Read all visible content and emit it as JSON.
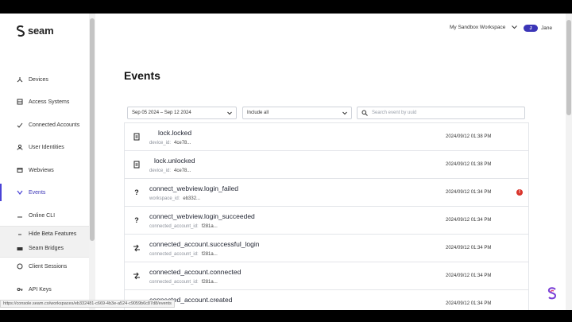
{
  "brand": {
    "name": "seam"
  },
  "header": {
    "workspace": "My Sandbox Workspace",
    "user_initial": "J",
    "user_name": "Jane"
  },
  "sidebar": {
    "items": [
      {
        "label": "Devices",
        "icon": "devices-icon"
      },
      {
        "label": "Access Systems",
        "icon": "access-systems-icon"
      },
      {
        "label": "Connected Accounts",
        "icon": "connected-accounts-icon"
      },
      {
        "label": "User Identities",
        "icon": "user-identities-icon"
      },
      {
        "label": "Webviews",
        "icon": "webviews-icon"
      },
      {
        "label": "Events",
        "icon": "events-icon",
        "active": true
      },
      {
        "label": "Online CLI",
        "icon": "cli-icon"
      }
    ],
    "beta": {
      "toggle_label": "Hide Beta Features",
      "bridges_label": "Seam Bridges"
    },
    "bottom": [
      {
        "label": "Client Sessions",
        "icon": "client-sessions-icon"
      },
      {
        "label": "API Keys",
        "icon": "api-keys-icon"
      }
    ]
  },
  "page": {
    "title": "Events"
  },
  "filters": {
    "date_range": "Sep 05 2024 – Sep 12 2024",
    "include": "Include all",
    "search_placeholder": "Search event by uuid"
  },
  "events": [
    {
      "name": "lock.locked",
      "key": "device_id:",
      "value": "4ce78...",
      "time": "2024/09/12 01:38 PM",
      "icon": "lock-icon",
      "error": false
    },
    {
      "name": "lock.unlocked",
      "key": "device_id:",
      "value": "4ce78...",
      "time": "2024/09/12 01:38 PM",
      "icon": "lock-icon",
      "error": false
    },
    {
      "name": "connect_webview.login_failed",
      "key": "workspace_id:",
      "value": "eb332...",
      "time": "2024/09/12 01:34 PM",
      "icon": "question-icon",
      "error": true
    },
    {
      "name": "connect_webview.login_succeeded",
      "key": "connected_account_id:",
      "value": "f281a...",
      "time": "2024/09/12 01:34 PM",
      "icon": "question-icon",
      "error": false
    },
    {
      "name": "connected_account.successful_login",
      "key": "connected_account_id:",
      "value": "f281a...",
      "time": "2024/09/12 01:34 PM",
      "icon": "transfer-icon",
      "error": false
    },
    {
      "name": "connected_account.connected",
      "key": "connected_account_id:",
      "value": "f281a...",
      "time": "2024/09/12 01:34 PM",
      "icon": "transfer-icon",
      "error": false
    },
    {
      "name": "connected_account.created",
      "key": "",
      "value": "",
      "time": "2024/09/12 01:34 PM",
      "icon": "transfer-icon",
      "error": false
    }
  ],
  "error_badge": "!",
  "status_bar": {
    "url": "https://console.seam.co/workspaces/eb332481-c669-4b3e-a524-c9059b6c87d8/events"
  },
  "colors": {
    "accent": "#4a43d6",
    "error": "#d9342b"
  }
}
